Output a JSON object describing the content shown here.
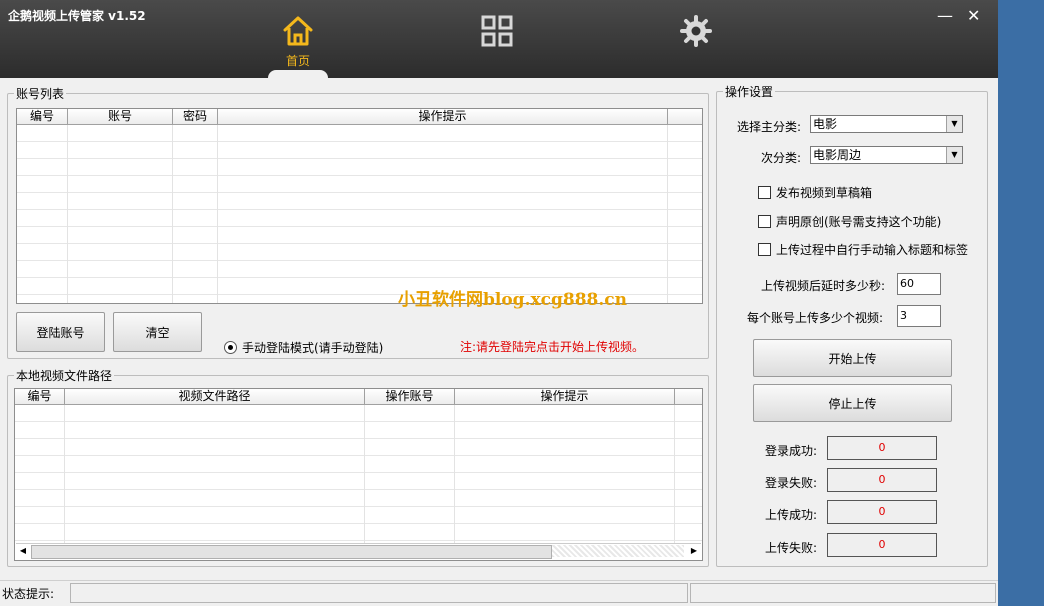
{
  "window": {
    "title": "企鹅视频上传管家 v1.52",
    "minimize_glyph": "—",
    "close_glyph": "✕"
  },
  "nav": [
    {
      "label": "首页",
      "icon": "home-icon",
      "active": true
    },
    {
      "label": "",
      "icon": "grid-icon"
    },
    {
      "label": "",
      "icon": "gear-icon"
    }
  ],
  "accounts": {
    "legend": "账号列表",
    "columns": [
      "编号",
      "账号",
      "密码",
      "操作提示"
    ],
    "rows": [],
    "login_button": "登陆账号",
    "clear_button": "清空",
    "manual_mode_label": "手动登陆模式(请手动登陆)",
    "notice": "注:请先登陆完点击开始上传视频。"
  },
  "watermark": "小丑软件网blog.xcg888.cn",
  "videos": {
    "legend": "本地视频文件路径",
    "columns": [
      "编号",
      "视频文件路径",
      "操作账号",
      "操作提示"
    ],
    "rows": []
  },
  "settings": {
    "legend": "操作设置",
    "main_category_label": "选择主分类:",
    "main_category_value": "电影",
    "sub_category_label": "次分类:",
    "sub_category_value": "电影周边",
    "publish_draft_label": "发布视频到草稿箱",
    "original_label": "声明原创(账号需支持这个功能)",
    "manual_tags_label": "上传过程中自行手动输入标题和标签",
    "delay_label": "上传视频后延时多少秒:",
    "delay_value": "60",
    "per_account_label": "每个账号上传多少个视频:",
    "per_account_value": "3",
    "start_button": "开始上传",
    "stop_button": "停止上传",
    "stats": [
      {
        "label": "登录成功:",
        "value": "0"
      },
      {
        "label": "登录失败:",
        "value": "0"
      },
      {
        "label": "上传成功:",
        "value": "0"
      },
      {
        "label": "上传失败:",
        "value": "0"
      }
    ]
  },
  "status": {
    "label": "状态提示:"
  },
  "colors": {
    "title_bg": "#333333",
    "accent": "#f4b81c",
    "stat_text": "#e00000",
    "notice_text": "#e00000",
    "watermark": "#e8a000"
  }
}
